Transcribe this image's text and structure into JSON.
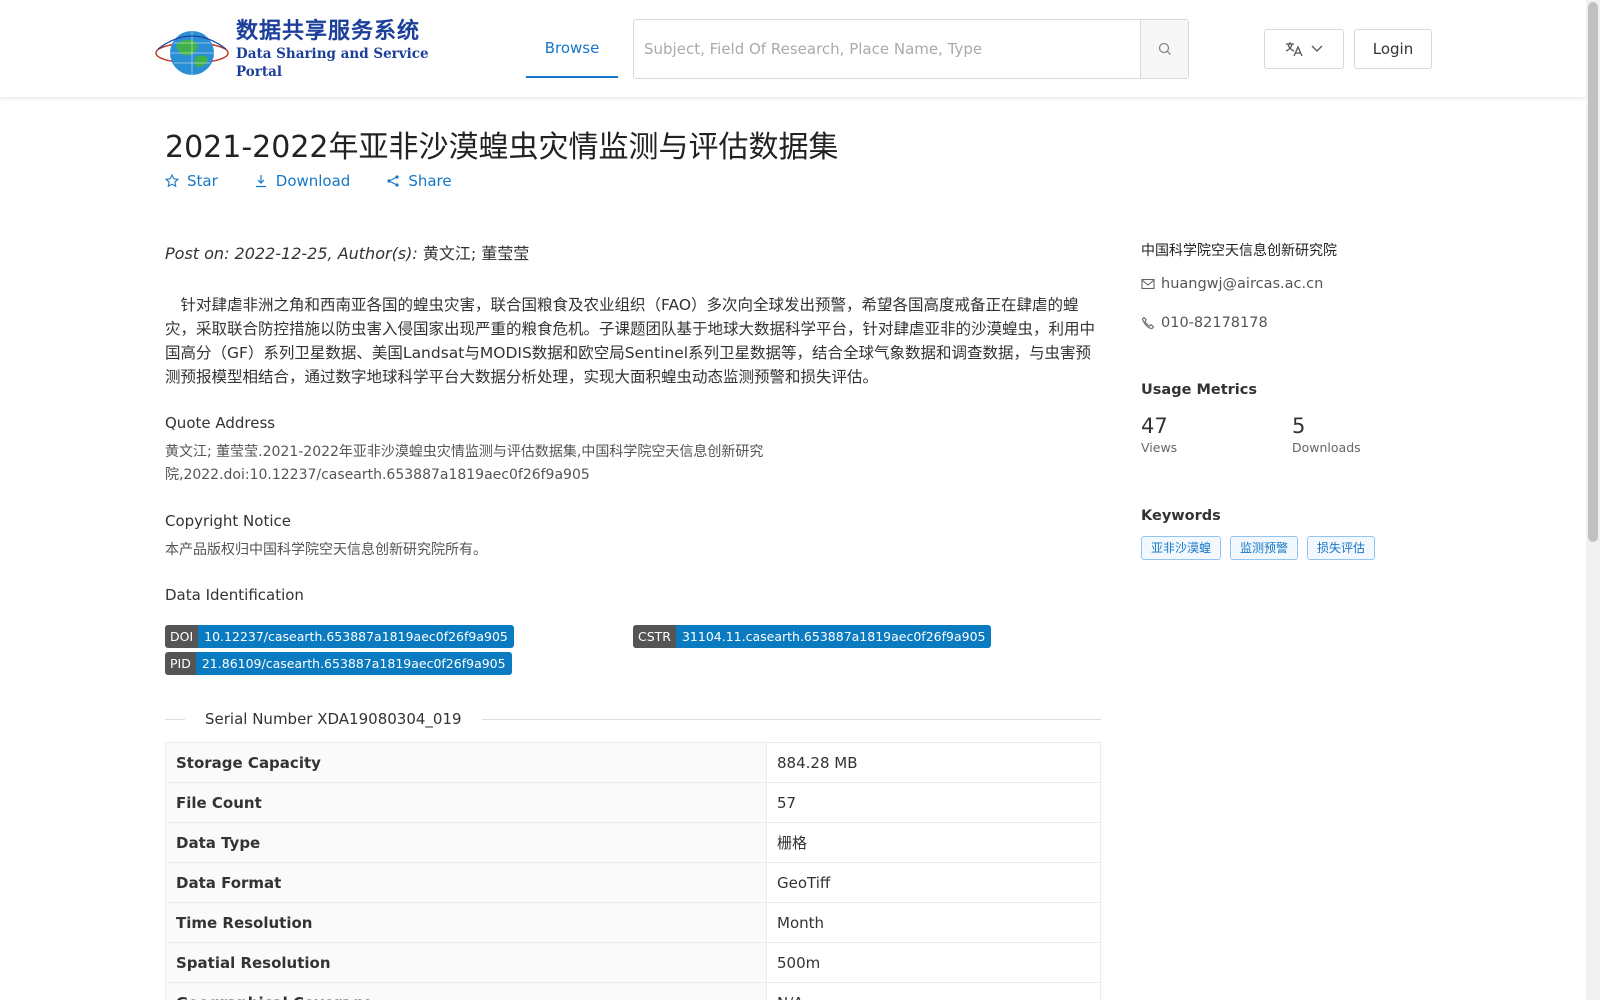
{
  "header": {
    "logo_cn": "数据共享服务系统",
    "logo_en": "Data Sharing and Service Portal",
    "nav_browse": "Browse",
    "search_placeholder": "Subject, Field Of Research, Place Name, Type",
    "login_label": "Login"
  },
  "dataset": {
    "title": "2021-2022年亚非沙漠蝗虫灾情监测与评估数据集",
    "actions": {
      "star": "Star",
      "download": "Download",
      "share": "Share"
    },
    "post_prefix": "Post on: 2022-12-25, Author(s): ",
    "authors": "黄文江; 董莹莹",
    "abstract": "针对肆虐非洲之角和西南亚各国的蝗虫灾害，联合国粮食及农业组织（FAO）多次向全球发出预警，希望各国高度戒备正在肆虐的蝗灾，采取联合防控措施以防虫害入侵国家出现严重的粮食危机。子课题团队基于地球大数据科学平台，针对肆虐亚非的沙漠蝗虫，利用中国高分（GF）系列卫星数据、美国Landsat与MODIS数据和欧空局Sentinel系列卫星数据等，结合全球气象数据和调查数据，与虫害预测预报模型相结合，通过数字地球科学平台大数据分析处理，实现大面积蝗虫动态监测预警和损失评估。",
    "quote_label": "Quote Address",
    "quote_text_1": "黄文江; 董莹莹.2021-2022年亚非沙漠蝗虫灾情监测与评估数据集,中国科学院空天信息创新研究",
    "quote_text_2": "院,2022.doi:10.12237/casearth.653887a1819aec0f26f9a905",
    "copyright_label": "Copyright Notice",
    "copyright_text": "本产品版权归中国科学院空天信息创新研究院所有。",
    "identification_label": "Data Identification",
    "ids": {
      "doi_key": "DOI",
      "doi_value": "10.12237/casearth.653887a1819aec0f26f9a905",
      "cstr_key": "CSTR",
      "cstr_value": "31104.11.casearth.653887a1819aec0f26f9a905",
      "pid_key": "PID",
      "pid_value": "21.86109/casearth.653887a1819aec0f26f9a905"
    },
    "serial": "Serial Number XDA19080304_019",
    "table": [
      {
        "key": "Storage Capacity",
        "value": "884.28 MB"
      },
      {
        "key": "File Count",
        "value": "57"
      },
      {
        "key": "Data Type",
        "value": "栅格"
      },
      {
        "key": "Data Format",
        "value": "GeoTiff"
      },
      {
        "key": "Time Resolution",
        "value": "Month"
      },
      {
        "key": "Spatial Resolution",
        "value": "500m"
      },
      {
        "key": "Geographical Coverage",
        "value": "N/A"
      }
    ]
  },
  "sidebar": {
    "institution": "中国科学院空天信息创新研究院",
    "email": "huangwj@aircas.ac.cn",
    "phone": "010-82178178",
    "metrics_title": "Usage Metrics",
    "views_num": "47",
    "views_label": "Views",
    "downloads_num": "5",
    "downloads_label": "Downloads",
    "keywords_title": "Keywords",
    "keywords": [
      "亚非沙漠蝗",
      "监测预警",
      "损失评估"
    ]
  },
  "colors": {
    "accent": "#1677c8",
    "badge_value": "#0a7bc1",
    "logo": "#1b3f9a"
  }
}
